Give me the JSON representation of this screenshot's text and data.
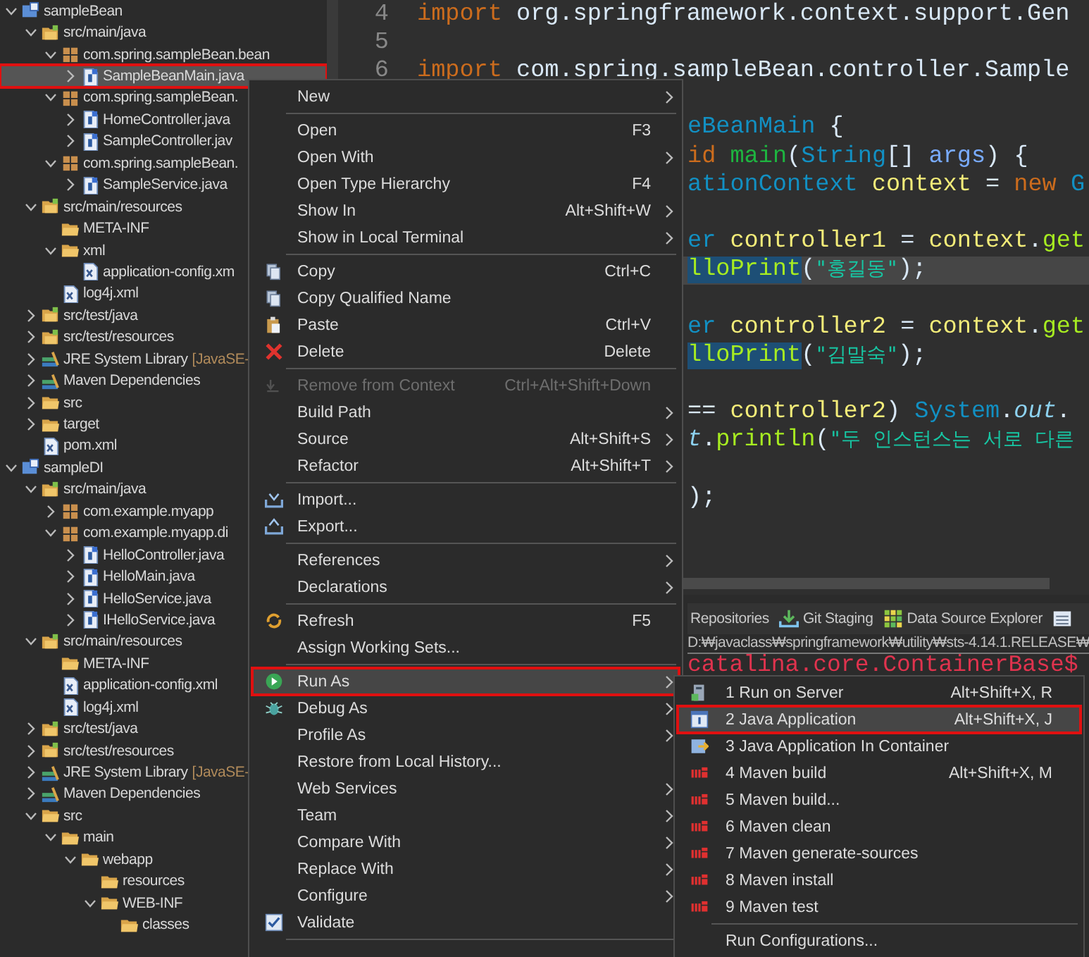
{
  "project_explorer": {
    "items": [
      {
        "label": "sampleBean",
        "kind": "project",
        "expanded": true,
        "selected": false,
        "highlighted": false,
        "children": [
          {
            "label": "src/main/java",
            "kind": "source-folder",
            "expanded": true,
            "selected": false,
            "highlighted": false,
            "children": [
              {
                "label": "com.spring.sampleBean.bean",
                "kind": "package",
                "expanded": true,
                "selected": false,
                "highlighted": false,
                "children": [
                  {
                    "label": "SampleBeanMain.java",
                    "kind": "java",
                    "expanded": false,
                    "selected": true,
                    "highlighted": true
                  }
                ]
              },
              {
                "label": "com.spring.sampleBean.",
                "kind": "package",
                "expanded": true,
                "selected": false,
                "highlighted": false,
                "children": [
                  {
                    "label": "HomeController.java",
                    "kind": "java",
                    "expanded": false,
                    "selected": false,
                    "highlighted": false
                  },
                  {
                    "label": "SampleController.jav",
                    "kind": "java",
                    "expanded": false,
                    "selected": false,
                    "highlighted": false
                  }
                ]
              },
              {
                "label": "com.spring.sampleBean.",
                "kind": "package",
                "expanded": true,
                "selected": false,
                "highlighted": false,
                "children": [
                  {
                    "label": "SampleService.java",
                    "kind": "java",
                    "expanded": false,
                    "selected": false,
                    "highlighted": false
                  }
                ]
              }
            ]
          },
          {
            "label": "src/main/resources",
            "kind": "source-folder",
            "expanded": true,
            "selected": false,
            "highlighted": false,
            "children": [
              {
                "label": "META-INF",
                "kind": "folder",
                "selected": false,
                "highlighted": false
              },
              {
                "label": "xml",
                "kind": "folder",
                "expanded": true,
                "selected": false,
                "highlighted": false,
                "children": [
                  {
                    "label": "application-config.xm",
                    "kind": "xml",
                    "selected": false,
                    "highlighted": false
                  }
                ]
              },
              {
                "label": "log4j.xml",
                "kind": "xml",
                "selected": false,
                "highlighted": false
              }
            ]
          },
          {
            "label": "src/test/java",
            "kind": "source-folder",
            "expanded": false,
            "selected": false,
            "highlighted": false
          },
          {
            "label": "src/test/resources",
            "kind": "source-folder",
            "expanded": false,
            "selected": false,
            "highlighted": false
          },
          {
            "label": "JRE System Library",
            "decoration": "[JavaSE-",
            "kind": "library",
            "expanded": false,
            "selected": false,
            "highlighted": false
          },
          {
            "label": "Maven Dependencies",
            "kind": "library",
            "expanded": false,
            "selected": false,
            "highlighted": false
          },
          {
            "label": "src",
            "kind": "folder",
            "expanded": false,
            "selected": false,
            "highlighted": false
          },
          {
            "label": "target",
            "kind": "folder",
            "expanded": false,
            "selected": false,
            "highlighted": false
          },
          {
            "label": "pom.xml",
            "kind": "xml",
            "selected": false,
            "highlighted": false
          }
        ]
      },
      {
        "label": "sampleDI",
        "kind": "project",
        "expanded": true,
        "selected": false,
        "highlighted": false,
        "children": [
          {
            "label": "src/main/java",
            "kind": "source-folder",
            "expanded": true,
            "selected": false,
            "highlighted": false,
            "children": [
              {
                "label": "com.example.myapp",
                "kind": "package",
                "expanded": false,
                "selected": false,
                "highlighted": false
              },
              {
                "label": "com.example.myapp.di",
                "kind": "package",
                "expanded": true,
                "selected": false,
                "highlighted": false,
                "children": [
                  {
                    "label": "HelloController.java",
                    "kind": "java",
                    "expanded": false,
                    "selected": false,
                    "highlighted": false
                  },
                  {
                    "label": "HelloMain.java",
                    "kind": "java",
                    "expanded": false,
                    "selected": false,
                    "highlighted": false
                  },
                  {
                    "label": "HelloService.java",
                    "kind": "java",
                    "expanded": false,
                    "selected": false,
                    "highlighted": false
                  },
                  {
                    "label": "IHelloService.java",
                    "kind": "java",
                    "expanded": false,
                    "selected": false,
                    "highlighted": false
                  }
                ]
              }
            ]
          },
          {
            "label": "src/main/resources",
            "kind": "source-folder",
            "expanded": true,
            "selected": false,
            "highlighted": false,
            "children": [
              {
                "label": "META-INF",
                "kind": "folder",
                "selected": false,
                "highlighted": false
              },
              {
                "label": "application-config.xml",
                "kind": "xml",
                "selected": false,
                "highlighted": false
              },
              {
                "label": "log4j.xml",
                "kind": "xml",
                "selected": false,
                "highlighted": false
              }
            ]
          },
          {
            "label": "src/test/java",
            "kind": "source-folder",
            "expanded": false,
            "selected": false,
            "highlighted": false
          },
          {
            "label": "src/test/resources",
            "kind": "source-folder",
            "expanded": false,
            "selected": false,
            "highlighted": false
          },
          {
            "label": "JRE System Library",
            "decoration": "[JavaSE-",
            "kind": "library",
            "expanded": false,
            "selected": false,
            "highlighted": false
          },
          {
            "label": "Maven Dependencies",
            "kind": "library",
            "expanded": false,
            "selected": false,
            "highlighted": false
          },
          {
            "label": "src",
            "kind": "folder",
            "expanded": true,
            "selected": false,
            "highlighted": false,
            "children": [
              {
                "label": "main",
                "kind": "folder",
                "expanded": true,
                "selected": false,
                "highlighted": false,
                "children": [
                  {
                    "label": "webapp",
                    "kind": "folder",
                    "expanded": true,
                    "selected": false,
                    "highlighted": false,
                    "children": [
                      {
                        "label": "resources",
                        "kind": "folder",
                        "selected": false,
                        "highlighted": false
                      },
                      {
                        "label": "WEB-INF",
                        "kind": "folder",
                        "expanded": true,
                        "selected": false,
                        "highlighted": false,
                        "children": [
                          {
                            "label": "classes",
                            "kind": "folder",
                            "selected": false,
                            "highlighted": false
                          }
                        ]
                      }
                    ]
                  }
                ]
              }
            ]
          }
        ]
      }
    ]
  },
  "editor": {
    "lines": [
      {
        "number": "4",
        "tokens": [
          {
            "kind": "keyword",
            "text": "import"
          },
          {
            "kind": "plain",
            "text": " org.springframework.context.support.Gen"
          }
        ]
      },
      {
        "number": "5"
      },
      {
        "number": "6",
        "tokens": [
          {
            "kind": "keyword",
            "text": "import"
          },
          {
            "kind": "plain",
            "text": " com.spring.sampleBean.controller.Sample"
          }
        ]
      }
    ],
    "covered_lines": [
      {
        "current": false
      },
      {
        "current": false,
        "tokens": [
          {
            "kind": "type",
            "text": "eBeanMain"
          },
          {
            "kind": "plain",
            "text": " {"
          }
        ]
      },
      {
        "current": false,
        "tokens": [
          {
            "kind": "keyword",
            "text": "id"
          },
          {
            "kind": "method-decl",
            "text": " main"
          },
          {
            "kind": "plain",
            "text": "("
          },
          {
            "kind": "type",
            "text": "String"
          },
          {
            "kind": "plain",
            "text": "[] "
          },
          {
            "kind": "param",
            "text": "args"
          },
          {
            "kind": "plain",
            "text": ") {"
          }
        ]
      },
      {
        "current": false,
        "tokens": [
          {
            "kind": "type",
            "text": "ationContext"
          },
          {
            "kind": "var",
            "text": " context"
          },
          {
            "kind": "plain",
            "text": " = "
          },
          {
            "kind": "keyword",
            "text": "new"
          },
          {
            "kind": "type",
            "text": " G"
          }
        ]
      },
      {
        "current": false
      },
      {
        "current": false,
        "tokens": [
          {
            "kind": "type",
            "text": "er"
          },
          {
            "kind": "var",
            "text": " controller1"
          },
          {
            "kind": "plain",
            "text": " = "
          },
          {
            "kind": "var",
            "text": "context"
          },
          {
            "kind": "plain",
            "text": "."
          },
          {
            "kind": "method",
            "text": "get"
          }
        ]
      },
      {
        "current": true,
        "tokens": [
          {
            "kind": "occurrence",
            "text": "lloPrint"
          },
          {
            "kind": "plain",
            "text": "("
          },
          {
            "kind": "string",
            "text": "\"홍길동\""
          },
          {
            "kind": "plain",
            "text": ");"
          }
        ]
      },
      {
        "current": false
      },
      {
        "current": false,
        "tokens": [
          {
            "kind": "type",
            "text": "er"
          },
          {
            "kind": "var",
            "text": " controller2"
          },
          {
            "kind": "plain",
            "text": " = "
          },
          {
            "kind": "var",
            "text": "context"
          },
          {
            "kind": "plain",
            "text": "."
          },
          {
            "kind": "method",
            "text": "get"
          }
        ]
      },
      {
        "current": false,
        "tokens": [
          {
            "kind": "occurrence",
            "text": "lloPrint"
          },
          {
            "kind": "plain",
            "text": "("
          },
          {
            "kind": "string",
            "text": "\"김말숙\""
          },
          {
            "kind": "plain",
            "text": ");"
          }
        ]
      },
      {
        "current": false
      },
      {
        "current": false,
        "tokens": [
          {
            "kind": "plain",
            "text": "== "
          },
          {
            "kind": "var",
            "text": "controller2"
          },
          {
            "kind": "plain",
            "text": ") "
          },
          {
            "kind": "type",
            "text": "System"
          },
          {
            "kind": "plain",
            "text": "."
          },
          {
            "kind": "field",
            "text": "out"
          },
          {
            "kind": "plain",
            "text": "."
          }
        ]
      },
      {
        "current": false,
        "tokens": [
          {
            "kind": "field",
            "text": "t"
          },
          {
            "kind": "plain",
            "text": "."
          },
          {
            "kind": "method",
            "text": "println"
          },
          {
            "kind": "plain",
            "text": "("
          },
          {
            "kind": "string",
            "text": "\"두 인스턴스는 서로 다른"
          }
        ]
      },
      {
        "current": false
      },
      {
        "current": false,
        "tokens": [
          {
            "kind": "plain",
            "text": ");"
          }
        ]
      }
    ]
  },
  "bottom_panel": {
    "tabs": [
      {
        "label": "Repositories"
      },
      {
        "label": "Git Staging",
        "kind": "download"
      },
      {
        "label": "Data Source Explorer",
        "kind": "grid"
      },
      {
        "kind": "list"
      }
    ],
    "console_path": "D:₩javaclass₩springframework₩utility₩sts-4.14.1.RELEASE₩",
    "console_output": "catalina.core.ContainerBase$"
  },
  "context_menu": {
    "groups": [
      [
        {
          "label": "New",
          "submenu": true,
          "disabled": false,
          "selected": false,
          "highlighted": false
        }
      ],
      [
        {
          "label": "Open",
          "shortcut": "F3",
          "submenu": false,
          "disabled": false,
          "selected": false,
          "highlighted": false
        },
        {
          "label": "Open With",
          "submenu": true,
          "disabled": false,
          "selected": false,
          "highlighted": false
        },
        {
          "label": "Open Type Hierarchy",
          "shortcut": "F4",
          "submenu": false,
          "disabled": false,
          "selected": false,
          "highlighted": false
        },
        {
          "label": "Show In",
          "shortcut": "Alt+Shift+W",
          "submenu": true,
          "disabled": false,
          "selected": false,
          "highlighted": false
        },
        {
          "label": "Show in Local Terminal",
          "submenu": true,
          "disabled": false,
          "selected": false,
          "highlighted": false
        }
      ],
      [
        {
          "label": "Copy",
          "shortcut": "Ctrl+C",
          "kind": "copy",
          "submenu": false,
          "disabled": false,
          "selected": false,
          "highlighted": false
        },
        {
          "label": "Copy Qualified Name",
          "kind": "copy",
          "submenu": false,
          "disabled": false,
          "selected": false,
          "highlighted": false
        },
        {
          "label": "Paste",
          "shortcut": "Ctrl+V",
          "kind": "paste",
          "submenu": false,
          "disabled": false,
          "selected": false,
          "highlighted": false
        },
        {
          "label": "Delete",
          "shortcut": "Delete",
          "kind": "delete",
          "submenu": false,
          "disabled": false,
          "selected": false,
          "highlighted": false
        }
      ],
      [
        {
          "label": "Remove from Context",
          "shortcut": "Ctrl+Alt+Shift+Down",
          "kind": "remove",
          "submenu": false,
          "disabled": true,
          "selected": false,
          "highlighted": false
        },
        {
          "label": "Build Path",
          "submenu": true,
          "disabled": false,
          "selected": false,
          "highlighted": false
        },
        {
          "label": "Source",
          "shortcut": "Alt+Shift+S",
          "submenu": true,
          "disabled": false,
          "selected": false,
          "highlighted": false
        },
        {
          "label": "Refactor",
          "shortcut": "Alt+Shift+T",
          "submenu": true,
          "disabled": false,
          "selected": false,
          "highlighted": false
        }
      ],
      [
        {
          "label": "Import...",
          "kind": "import",
          "submenu": false,
          "disabled": false,
          "selected": false,
          "highlighted": false
        },
        {
          "label": "Export...",
          "kind": "export",
          "submenu": false,
          "disabled": false,
          "selected": false,
          "highlighted": false
        }
      ],
      [
        {
          "label": "References",
          "submenu": true,
          "disabled": false,
          "selected": false,
          "highlighted": false
        },
        {
          "label": "Declarations",
          "submenu": true,
          "disabled": false,
          "selected": false,
          "highlighted": false
        }
      ],
      [
        {
          "label": "Refresh",
          "shortcut": "F5",
          "kind": "refresh",
          "submenu": false,
          "disabled": false,
          "selected": false,
          "highlighted": false
        },
        {
          "label": "Assign Working Sets...",
          "submenu": false,
          "disabled": false,
          "selected": false,
          "highlighted": false
        }
      ],
      [
        {
          "label": "Run As",
          "kind": "run",
          "submenu": true,
          "disabled": false,
          "selected": true,
          "highlighted": true
        },
        {
          "label": "Debug As",
          "kind": "debug",
          "submenu": true,
          "disabled": false,
          "selected": false,
          "highlighted": false
        },
        {
          "label": "Profile As",
          "submenu": true,
          "disabled": false,
          "selected": false,
          "highlighted": false
        },
        {
          "label": "Restore from Local History...",
          "submenu": false,
          "disabled": false,
          "selected": false,
          "highlighted": false
        },
        {
          "label": "Web Services",
          "submenu": true,
          "disabled": false,
          "selected": false,
          "highlighted": false
        },
        {
          "label": "Team",
          "submenu": true,
          "disabled": false,
          "selected": false,
          "highlighted": false
        },
        {
          "label": "Compare With",
          "submenu": true,
          "disabled": false,
          "selected": false,
          "highlighted": false
        },
        {
          "label": "Replace With",
          "submenu": true,
          "disabled": false,
          "selected": false,
          "highlighted": false
        },
        {
          "label": "Configure",
          "submenu": true,
          "disabled": false,
          "selected": false,
          "highlighted": false
        },
        {
          "label": "Validate",
          "kind": "validate",
          "submenu": false,
          "disabled": false,
          "selected": false,
          "highlighted": false
        }
      ]
    ]
  },
  "submenu": {
    "groups": [
      [
        {
          "label": "1 Run on Server",
          "shortcut": "Alt+Shift+X, R",
          "kind": "server",
          "selected": false,
          "highlighted": false
        },
        {
          "label": "2 Java Application",
          "shortcut": "Alt+Shift+X, J",
          "kind": "java-app",
          "selected": true,
          "highlighted": true
        },
        {
          "label": "3 Java Application In Container",
          "kind": "container",
          "selected": false,
          "highlighted": false
        },
        {
          "label": "4 Maven build",
          "shortcut": "Alt+Shift+X, M",
          "kind": "maven",
          "selected": false,
          "highlighted": false
        },
        {
          "label": "5 Maven build...",
          "kind": "maven",
          "selected": false,
          "highlighted": false
        },
        {
          "label": "6 Maven clean",
          "kind": "maven",
          "selected": false,
          "highlighted": false
        },
        {
          "label": "7 Maven generate-sources",
          "kind": "maven",
          "selected": false,
          "highlighted": false
        },
        {
          "label": "8 Maven install",
          "kind": "maven",
          "selected": false,
          "highlighted": false
        },
        {
          "label": "9 Maven test",
          "kind": "maven",
          "selected": false,
          "highlighted": false
        }
      ],
      [
        {
          "label": "Run Configurations...",
          "selected": false,
          "highlighted": false
        }
      ]
    ]
  }
}
